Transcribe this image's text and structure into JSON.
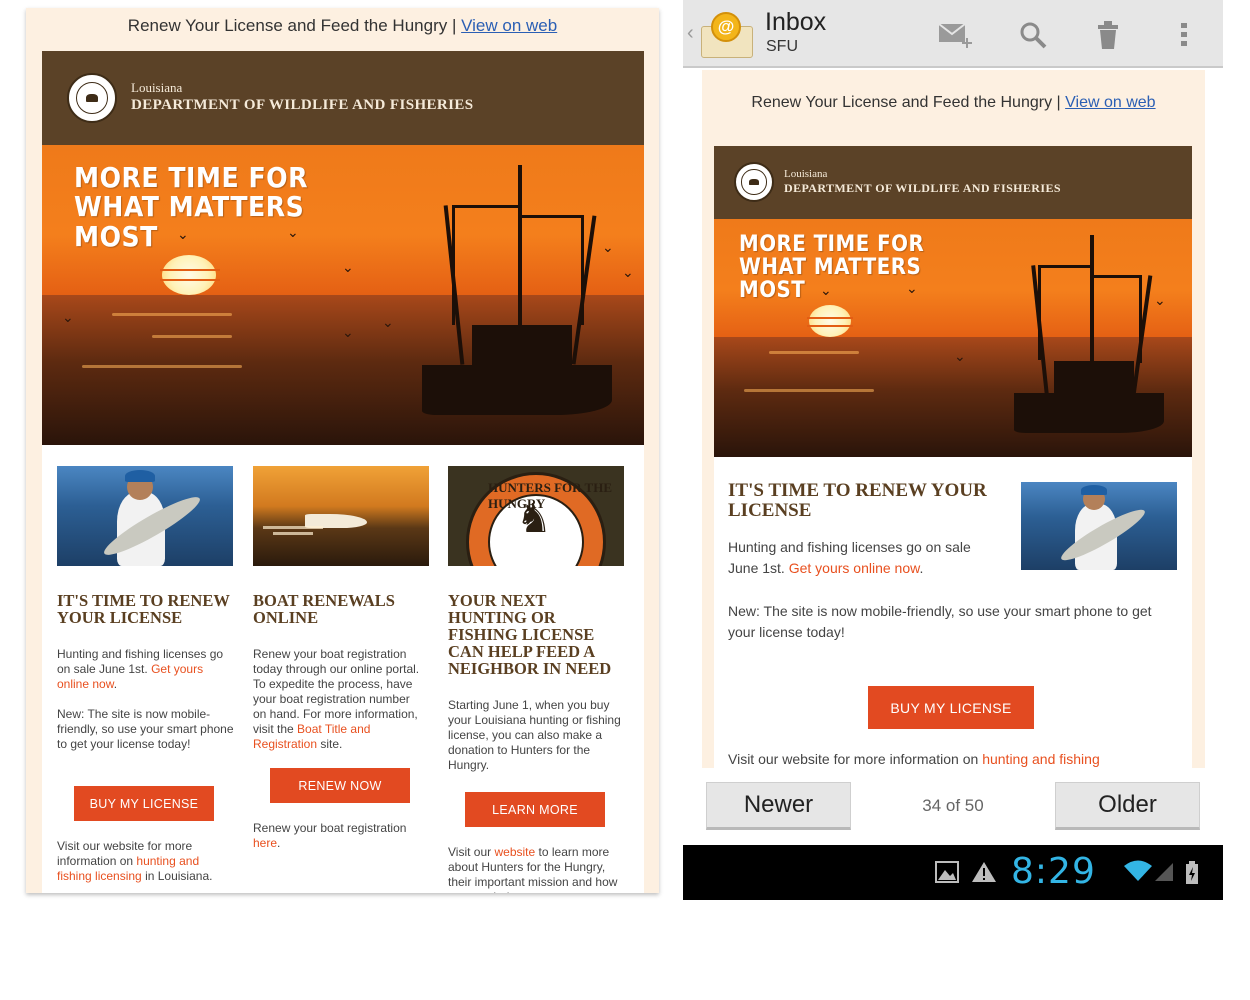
{
  "preheader": {
    "text": "Renew Your License and Feed the Hungry |",
    "link": "View on web"
  },
  "banner": {
    "state": "Louisiana",
    "department": "DEPARTMENT OF WILDLIFE AND FISHERIES"
  },
  "hero": {
    "headline": "MORE TIME FOR\nWHAT MATTERS\nMOST"
  },
  "columns": [
    {
      "heading": "IT'S TIME TO RENEW YOUR LICENSE",
      "p1_pre": "Hunting and fishing licenses go on sale June 1st.",
      "p1_link": "Get yours online now",
      "p1_post": ".",
      "p2": "New: The site is now mobile-friendly, so use your smart phone to get your license today!",
      "button": "BUY MY LICENSE",
      "footer_pre": "Visit our website for more information on",
      "footer_link": "hunting and fishing licensing",
      "footer_post": "in Louisiana."
    },
    {
      "heading": "BOAT RENEWALS ONLINE",
      "p1_pre": "Renew your boat registration today through our online portal. To expedite the process, have your boat registration number on hand. For more information, visit the",
      "p1_link": "Boat Title and Registration",
      "p1_post": "site.",
      "button": "RENEW NOW",
      "footer_pre": "Renew your boat registration",
      "footer_link": "here",
      "footer_post": "."
    },
    {
      "heading": "YOUR NEXT HUNTING OR FISHING LICENSE CAN HELP FEED A NEIGHBOR IN NEED",
      "p1": "Starting June 1, when you buy your Louisiana hunting or fishing license, you can also make a donation to Hunters for the Hungry.",
      "button": "LEARN MORE",
      "footer_pre": "Visit our",
      "footer_link": "website",
      "footer_post": "to learn more about Hunters for the Hungry, their important mission and how you can help.",
      "badge_text": "HUNTERS FOR THE HUNGRY"
    }
  ],
  "mobile": {
    "app_title": "Inbox",
    "account": "SFU",
    "icons": [
      "compose-icon",
      "search-icon",
      "delete-icon",
      "overflow-menu-icon"
    ],
    "heading": "IT'S TIME TO RENEW YOUR LICENSE",
    "p1_pre": "Hunting and fishing licenses go on sale June 1st.",
    "p1_link": "Get yours online now",
    "p1_post": ".",
    "p2": "New: The site is now mobile-friendly, so use your smart phone to get your license today!",
    "button": "BUY MY LICENSE",
    "footer_pre": "Visit our website for more information on",
    "footer_link": "hunting and fishing",
    "newer": "Newer",
    "older": "Older",
    "count": "34 of 50",
    "clock": "8:29"
  },
  "colors": {
    "banner": "#5b4227",
    "accent": "#e24a21",
    "link_orange": "#e8501f",
    "heading_brown": "#5a3f21",
    "page_bg": "#fdf0e1",
    "clock_blue": "#33b5e5"
  }
}
